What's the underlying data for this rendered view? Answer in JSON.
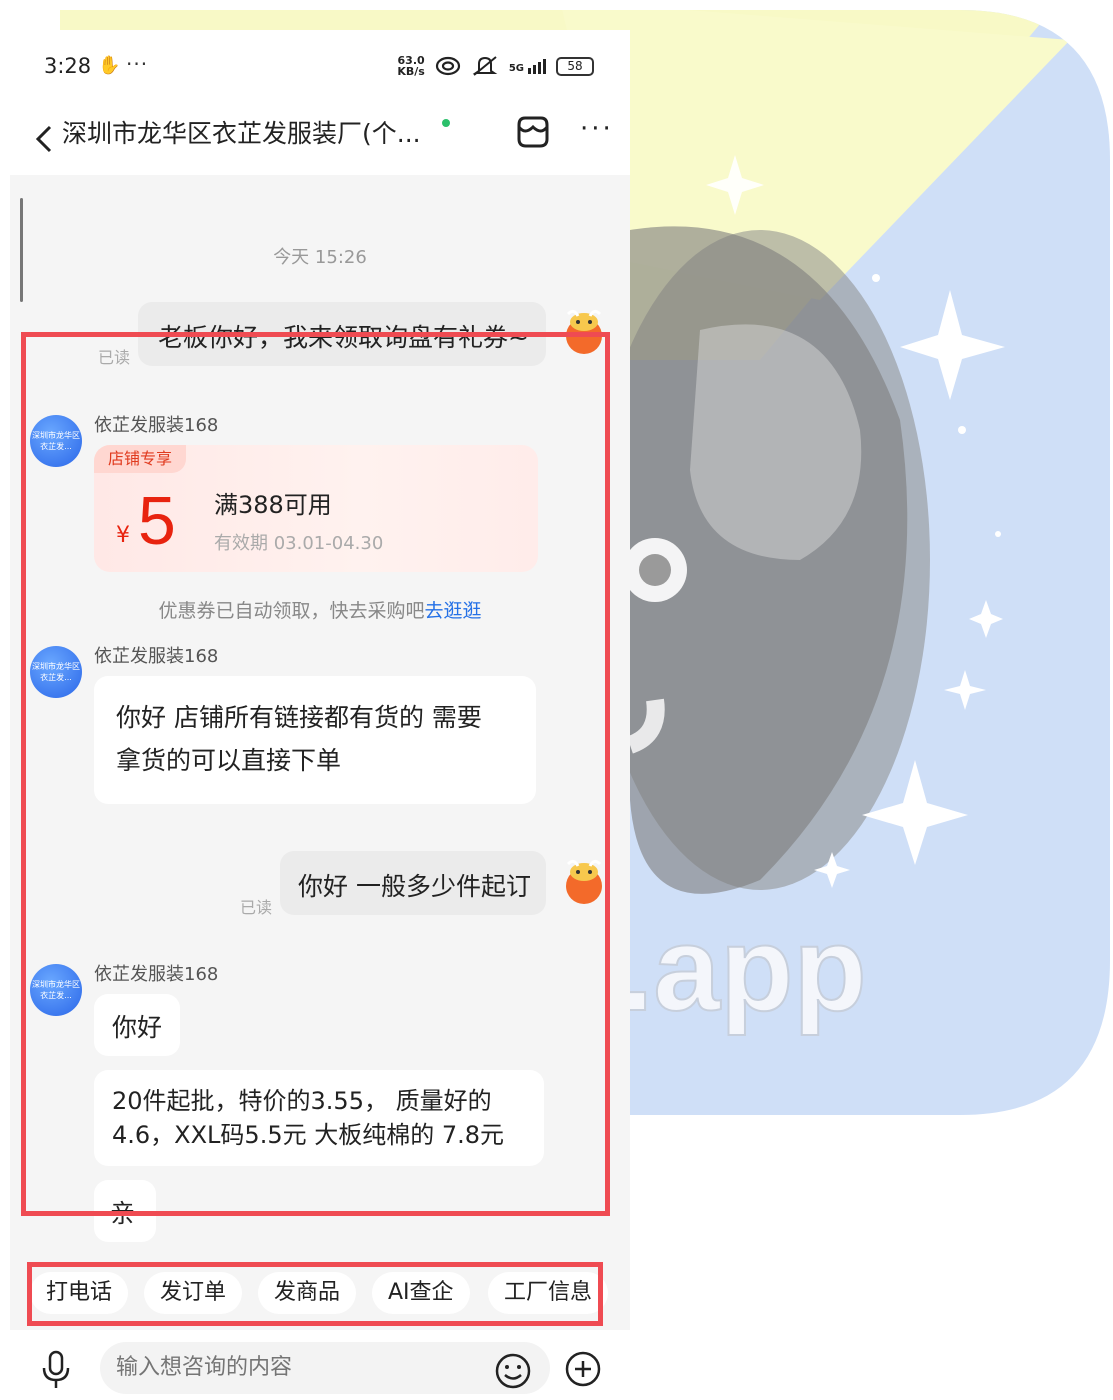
{
  "status_bar": {
    "time": "3:28",
    "more": "···",
    "net_speed_value": "63.0",
    "net_speed_unit": "KB/s",
    "signal_label": "5G",
    "battery": "58"
  },
  "header": {
    "title": "深圳市龙华区衣芷发服装厂(个...",
    "online_color": "#2bc06b"
  },
  "chat": {
    "time_divider": "今天 15:26",
    "messages": [
      {
        "direction": "out",
        "text": "老板你好，我来领取询盘有礼券~",
        "read": "已读"
      },
      {
        "direction": "in",
        "sender": "依芷发服装168",
        "avatar_text": "深圳市龙华区衣芷发..."
      },
      {
        "direction": "in",
        "sender": "依芷发服装168",
        "avatar_text": "深圳市龙华区衣芷发...",
        "text_line1": "你好 店铺所有链接都有货的 需要",
        "text_line2": "拿货的可以直接下单"
      },
      {
        "direction": "out",
        "text": "你好 一般多少件起订",
        "read": "已读"
      },
      {
        "direction": "in",
        "sender": "依芷发服装168",
        "avatar_text": "深圳市龙华区衣芷发...",
        "text": "你好"
      },
      {
        "direction": "in",
        "text_line1": "20件起批，特价的3.55，  质量好的",
        "text_line2": "4.6，XXL码5.5元  大板纯棉的 7.8元"
      },
      {
        "direction": "in",
        "text": "亲"
      }
    ],
    "coupon": {
      "tag": "店铺专享",
      "currency": "¥",
      "amount": "5",
      "condition": "满388可用",
      "validity": "有效期 03.01-04.30"
    },
    "system_note": "优惠券已自动领取，快去采购吧",
    "system_link": "去逛逛"
  },
  "quick_actions": [
    "打电话",
    "发订单",
    "发商品",
    "AI查企",
    "工厂信息"
  ],
  "input": {
    "placeholder": "输入想咨询的内容"
  },
  "colors": {
    "accent_red": "#e8230f",
    "link_blue": "#2470e6",
    "annotation": "#ef4b52"
  },
  "background_art": {
    "text": ".app"
  }
}
